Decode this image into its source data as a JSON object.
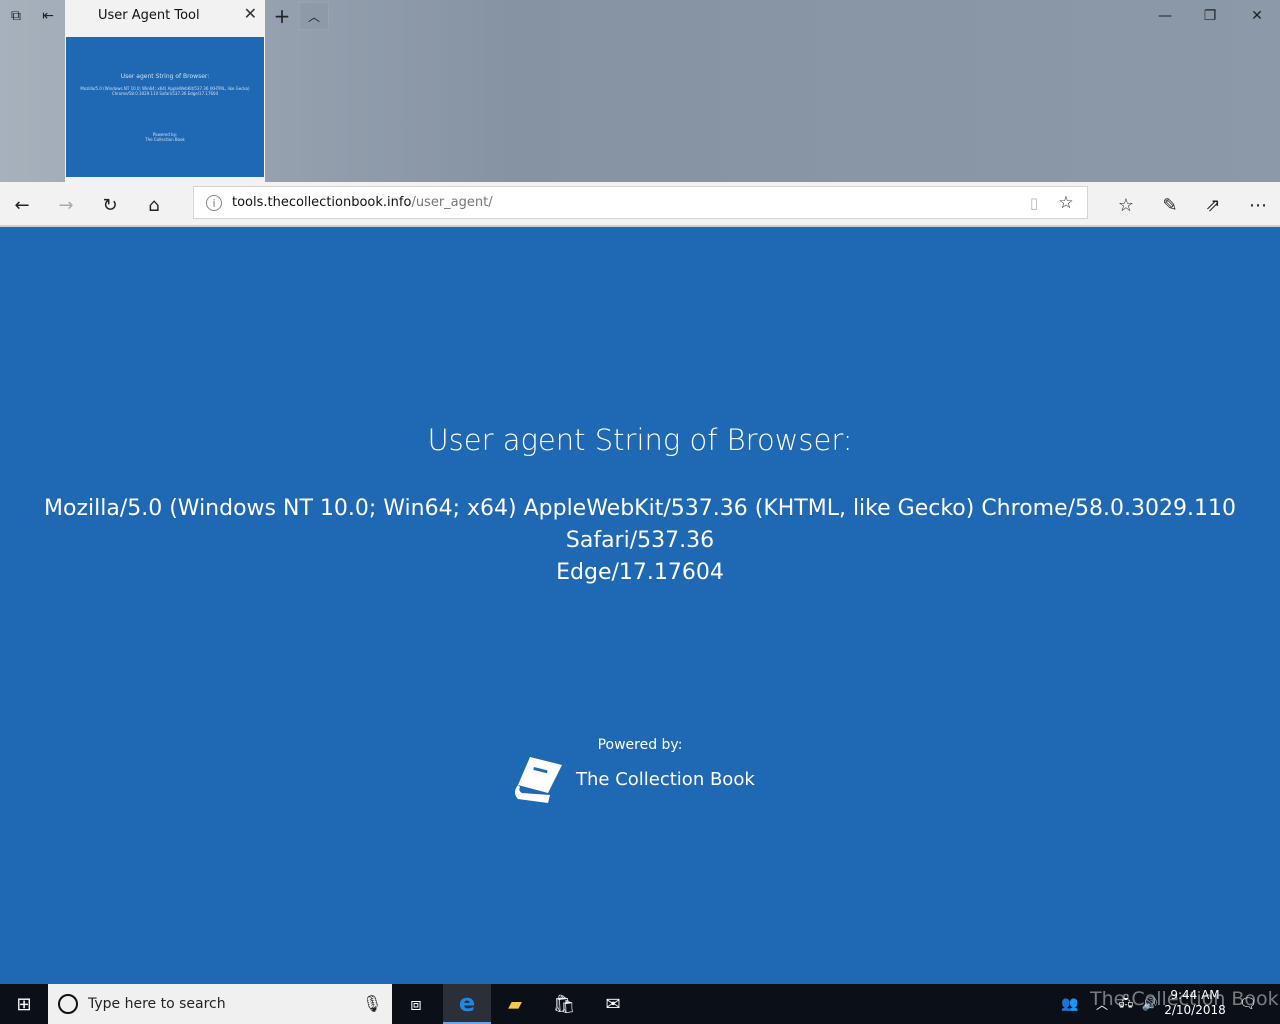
{
  "browser": {
    "tab_title": "User Agent Tool",
    "thumbnail": {
      "heading": "User agent String of Browser:",
      "text": "Mozilla/5.0 (Windows NT 10.0; Win64; x64) AppleWebKit/537.36 (KHTML, like Gecko) Chrome/58.0.3029.110 Safari/537.36 Edge/17.17604",
      "powered": "Powered by:",
      "brand": "The Collection Book"
    },
    "url_host": "tools.thecollectionbook.info",
    "url_path": "/user_agent/",
    "icons": [
      "tabs-aside-icon",
      "restore-tabs-icon",
      "close-icon",
      "plus-icon",
      "chevron-up-icon",
      "minimize-icon",
      "maximize-icon",
      "close-window-icon",
      "back-icon",
      "forward-icon",
      "refresh-icon",
      "home-icon",
      "info-icon",
      "reading-view-icon",
      "star-icon",
      "favorites-icon",
      "pen-icon",
      "share-icon",
      "more-icon"
    ]
  },
  "page": {
    "heading": "User agent String of Browser:",
    "user_agent_line1": "Mozilla/5.0 (Windows NT 10.0; Win64; x64) AppleWebKit/537.36 (KHTML, like Gecko) Chrome/58.0.3029.110 Safari/537.36",
    "user_agent_line2": "Edge/17.17604",
    "powered_by": "Powered by:",
    "brand": "The Collection Book"
  },
  "taskbar": {
    "search_placeholder": "Type here to search",
    "time": "9:44 AM",
    "date": "2/10/2018",
    "watermark": "The Collection Book"
  },
  "colors": {
    "page_bg": "#1f68b3",
    "taskbar": "#0b0f17",
    "edge_accent": "#1e88e5"
  }
}
